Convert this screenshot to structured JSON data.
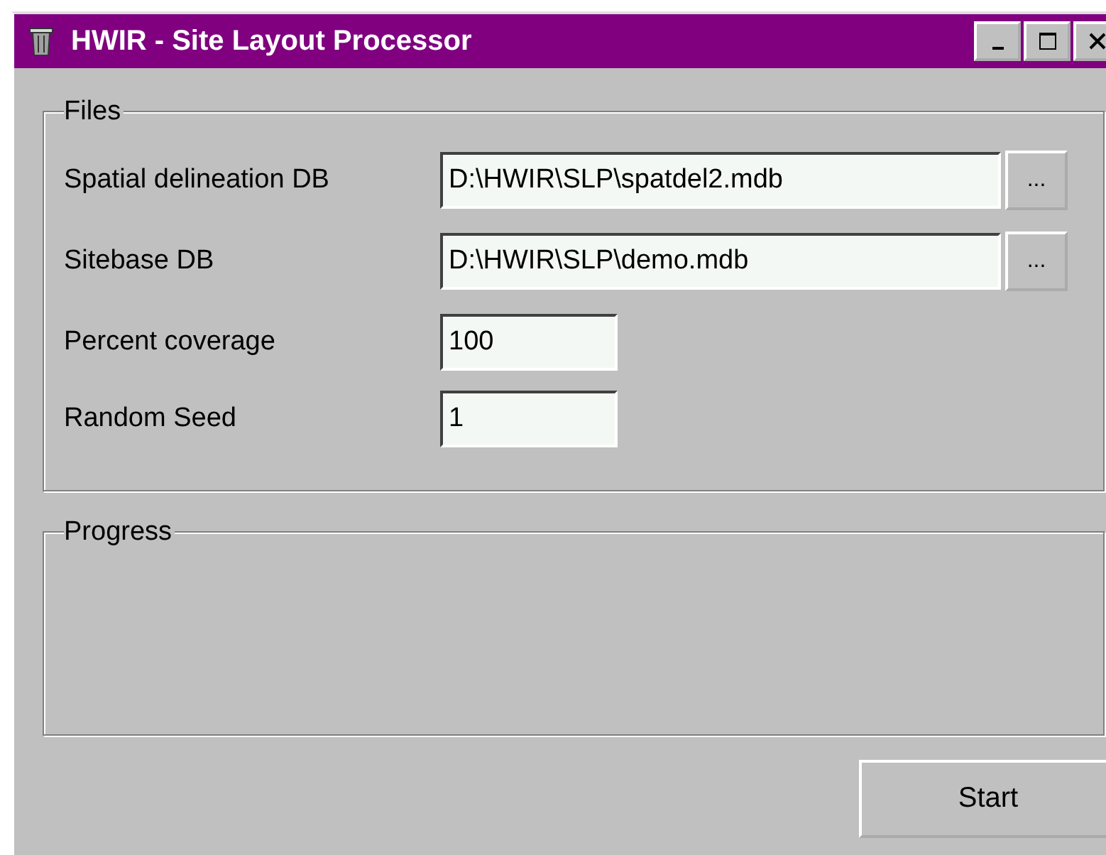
{
  "window": {
    "title": "HWIR - Site Layout Processor",
    "controls": [
      {
        "kind": "minimize"
      },
      {
        "kind": "maximize"
      },
      {
        "kind": "close"
      }
    ]
  },
  "files": {
    "title": "Files",
    "rows": [
      {
        "kind": "path",
        "label": "Spatial delineation DB",
        "value": "D:\\HWIR\\SLP\\spatdel2.mdb",
        "browse": "..."
      },
      {
        "kind": "path",
        "label": "Sitebase DB",
        "value": "D:\\HWIR\\SLP\\demo.mdb",
        "browse": "..."
      },
      {
        "kind": "short",
        "label": "Percent coverage",
        "value": "100"
      },
      {
        "kind": "short",
        "label": "Random Seed",
        "value": "1"
      }
    ]
  },
  "progress": {
    "title": "Progress"
  },
  "buttons": [
    "Start"
  ]
}
